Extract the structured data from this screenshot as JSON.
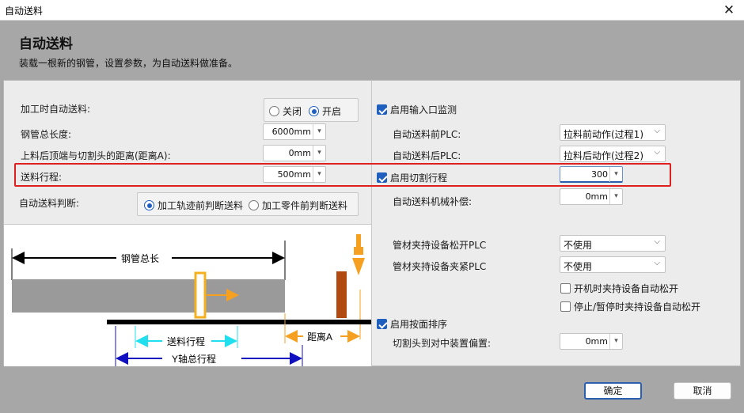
{
  "window": {
    "title": "自动送料"
  },
  "header": {
    "title": "自动送料",
    "subtitle": "装载一根新的钢管，设置参数，为自动送料做准备。"
  },
  "left": {
    "auto_feed_label": "加工时自动送料:",
    "auto_feed_options": [
      "关闭",
      "开启"
    ],
    "auto_feed_selected": "开启",
    "tube_length_label": "钢管总长度:",
    "tube_length_value": "6000mm",
    "distance_a_label": "上料后顶端与切割头的距离(距离A):",
    "distance_a_value": "0mm",
    "feed_travel_label": "送料行程:",
    "feed_travel_value": "500mm",
    "judge_label": "自动送料判断:",
    "judge_options": [
      "加工轨迹前判断送料",
      "加工零件前判断送料"
    ],
    "judge_selected": "加工轨迹前判断送料"
  },
  "right": {
    "input_monitor_label": "启用输入口监测",
    "input_monitor_checked": true,
    "before_plc_label": "自动送料前PLC:",
    "before_plc_value": "拉料前动作(过程1)",
    "after_plc_label": "自动送料后PLC:",
    "after_plc_value": "拉料后动作(过程2)",
    "cut_travel_label": "启用切割行程",
    "cut_travel_checked": true,
    "cut_travel_value": "300",
    "mech_comp_label": "自动送料机械补偿:",
    "mech_comp_value": "0mm",
    "clamp_release_label": "管材夹持设备松开PLC",
    "clamp_release_value": "不使用",
    "clamp_tight_label": "管材夹持设备夹紧PLC",
    "clamp_tight_value": "不使用",
    "startup_release_label": "开机时夹持设备自动松开",
    "startup_release_checked": false,
    "stop_release_label": "停止/暂停时夹持设备自动松开",
    "stop_release_checked": false,
    "button_sort_label": "启用按面排序",
    "button_sort_checked": true,
    "center_offset_label": "切割头到对中装置偏置:",
    "center_offset_value": "0mm"
  },
  "diagram": {
    "tube_length_text": "钢管总长",
    "feed_travel_text": "送料行程",
    "distance_a_text": "距离A",
    "y_travel_text": "Y轴总行程"
  },
  "footer": {
    "ok_label": "确定",
    "cancel_label": "取消"
  },
  "colors": {
    "accent": "#1f5fbf",
    "highlight": "#e02020",
    "orange": "#f5a020",
    "cyan": "#20e0f0",
    "blue": "#1010c0",
    "brown": "#b04a10"
  }
}
